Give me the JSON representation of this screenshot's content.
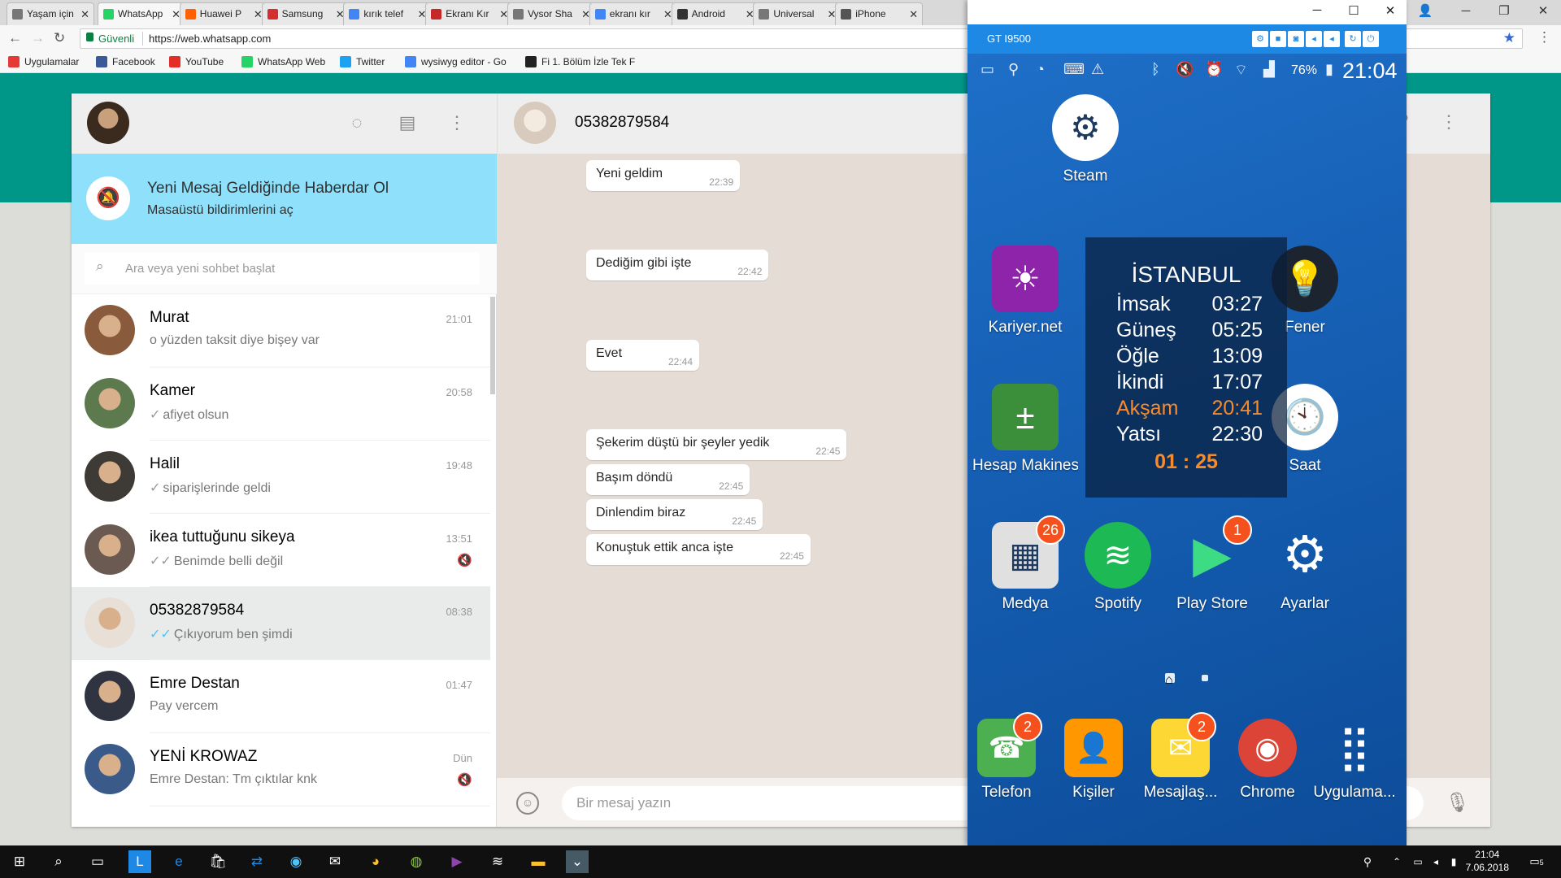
{
  "browser": {
    "tabs": [
      {
        "label": "Yaşam için",
        "fav": "doc",
        "color": "#777"
      },
      {
        "label": "WhatsApp",
        "fav": "whatsapp",
        "color": "#25d366",
        "active": true
      },
      {
        "label": "Huawei P",
        "fav": "hb",
        "color": "#ff6000"
      },
      {
        "label": "Samsung",
        "fav": "bug",
        "color": "#d32f2f"
      },
      {
        "label": "kırık telef",
        "fav": "G",
        "color": "#4285f4"
      },
      {
        "label": "Ekranı Kır",
        "fav": "BK",
        "color": "#c62828"
      },
      {
        "label": "Vysor Sha",
        "fav": "doc",
        "color": "#777"
      },
      {
        "label": "ekranı kır",
        "fav": "G",
        "color": "#4285f4"
      },
      {
        "label": "Android",
        "fav": "T",
        "color": "#333"
      },
      {
        "label": "Universal",
        "fav": "doc",
        "color": "#777"
      },
      {
        "label": "iPhone",
        "fav": "apple",
        "color": "#555"
      }
    ],
    "secure_label": "Güvenli",
    "url": "https://web.whatsapp.com",
    "bookmarks": [
      {
        "label": "Uygulamalar",
        "color": "#e53935"
      },
      {
        "label": "Facebook",
        "color": "#3b5998"
      },
      {
        "label": "YouTube",
        "color": "#e52d27"
      },
      {
        "label": "WhatsApp Web",
        "color": "#25d366"
      },
      {
        "label": "Twitter",
        "color": "#1da1f2"
      },
      {
        "label": "wysiwyg editor - Go",
        "color": "#4285f4"
      },
      {
        "label": "Fi 1. Bölüm İzle Tek F",
        "color": "#222"
      }
    ]
  },
  "whatsapp": {
    "notification": {
      "title": "Yeni Mesaj Geldiğinde Haberdar Ol",
      "subtitle": "Masaüstü bildirimlerini aç"
    },
    "search_placeholder": "Ara veya yeni sohbet başlat",
    "chats": [
      {
        "name": "Murat",
        "time": "21:01",
        "last": "o yüzden taksit diye bişey var",
        "tick": "",
        "muted": false,
        "avatar": "#8a5a3c"
      },
      {
        "name": "Kamer",
        "time": "20:58",
        "last": "afiyet olsun",
        "tick": "single",
        "muted": false,
        "avatar": "#5d7a4e"
      },
      {
        "name": "Halil",
        "time": "19:48",
        "last": "siparişlerinde geldi",
        "tick": "single",
        "muted": false,
        "avatar": "#3e3a36"
      },
      {
        "name": "ikea tuttuğunu sikeya",
        "time": "13:51",
        "last": "Benimde belli değil",
        "tick": "double",
        "muted": true,
        "avatar": "#6b5a52"
      },
      {
        "name": "05382879584",
        "time": "08:38",
        "last": "Çıkıyorum ben şimdi",
        "tick": "read",
        "muted": false,
        "avatar": "#e8dfd6",
        "active": true
      },
      {
        "name": "Emre Destan",
        "time": "01:47",
        "last": "Pay vercem",
        "tick": "",
        "muted": false,
        "avatar": "#2f3440"
      },
      {
        "name": "YENİ KROWAZ",
        "time": "Dün",
        "last": "Emre Destan: Tm çıktılar knk",
        "tick": "",
        "muted": true,
        "avatar": "#3a5a8a"
      }
    ],
    "conversation": {
      "title": "05382879584",
      "messages": [
        {
          "text": "Yeni geldim",
          "time": "22:39"
        },
        {
          "text": "Dediğim gibi işte",
          "time": "22:42"
        },
        {
          "text": "Evet",
          "time": "22:44"
        },
        {
          "text": "Şekerim düştü bir şeyler yedik",
          "time": "22:45"
        },
        {
          "text": "Başım döndü",
          "time": "22:45"
        },
        {
          "text": "Dinlendim biraz",
          "time": "22:45"
        },
        {
          "text": "Konuştuk ettik anca işte",
          "time": "22:45"
        }
      ],
      "input_placeholder": "Bir mesaj yazın"
    }
  },
  "vysor": {
    "device": "GT I9500",
    "battery": "76%",
    "clock": "21:04",
    "apps": [
      {
        "label": "Steam",
        "icon": "steam-icon",
        "color": "#ffffff"
      },
      {
        "label": "Kariyer.net",
        "icon": "kariyer-icon",
        "color": "#8e24aa"
      },
      {
        "label": "Fener",
        "icon": "flashlight-icon",
        "color": "#1c2430"
      },
      {
        "label": "Hesap Makinesi",
        "icon": "calculator-icon",
        "color": "#3b8f3b"
      },
      {
        "label": "Saat",
        "icon": "clock-icon",
        "color": "#ffffff"
      },
      {
        "label": "Medya",
        "icon": "media-folder-icon",
        "color": "#e0e0e0",
        "badge": "26"
      },
      {
        "label": "Spotify",
        "icon": "spotify-icon",
        "color": "#1db954"
      },
      {
        "label": "Play Store",
        "icon": "play-store-icon",
        "color": "#00c853",
        "badge": "1"
      },
      {
        "label": "Ayarlar",
        "icon": "settings-icon",
        "color": "#1e88e5"
      },
      {
        "label": "Telefon",
        "icon": "phone-icon",
        "color": "#4caf50",
        "badge": "2"
      },
      {
        "label": "Kişiler",
        "icon": "contacts-icon",
        "color": "#ff9800"
      },
      {
        "label": "Mesajlaş...",
        "icon": "messages-icon",
        "color": "#fdd835",
        "badge": "2"
      },
      {
        "label": "Chrome",
        "icon": "chrome-icon",
        "color": "#db4437"
      },
      {
        "label": "Uygulama...",
        "icon": "apps-grid-icon",
        "color": "#ffffff"
      }
    ],
    "prayer": {
      "city": "İSTANBUL",
      "times": [
        {
          "name": "İmsak",
          "time": "03:27"
        },
        {
          "name": "Güneş",
          "time": "05:25"
        },
        {
          "name": "Öğle",
          "time": "13:09"
        },
        {
          "name": "İkindi",
          "time": "17:07"
        },
        {
          "name": "Akşam",
          "time": "20:41",
          "highlight": true
        },
        {
          "name": "Yatsı",
          "time": "22:30"
        }
      ],
      "remaining": "01 : 25"
    }
  },
  "taskbar": {
    "time": "21:04",
    "date": "7.06.2018",
    "notifications": "5"
  }
}
